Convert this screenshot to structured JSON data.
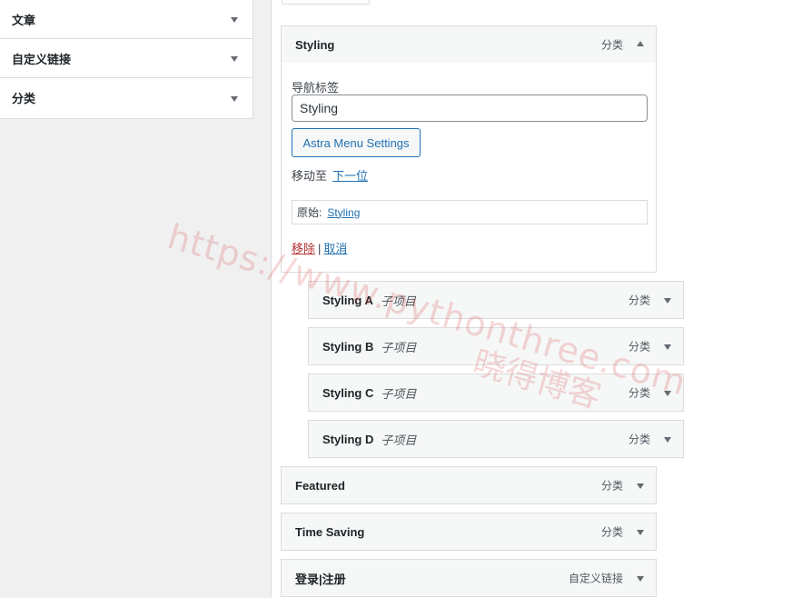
{
  "left_panel": {
    "items": [
      {
        "label": "文章"
      },
      {
        "label": "自定义链接"
      },
      {
        "label": "分类"
      }
    ]
  },
  "expanded_item": {
    "title": "Styling",
    "type": "分类",
    "nav_label_caption": "导航标签",
    "nav_label_value": "Styling",
    "astra_button": "Astra Menu Settings",
    "move_to_caption": "移动至",
    "move_next_link": "下一位",
    "original_caption": "原始:",
    "original_link": "Styling",
    "remove_link": "移除",
    "separator": "|",
    "cancel_link": "取消"
  },
  "sub_items": [
    {
      "title": "Styling A",
      "sub": "子项目",
      "type": "分类"
    },
    {
      "title": "Styling B",
      "sub": "子项目",
      "type": "分类"
    },
    {
      "title": "Styling C",
      "sub": "子项目",
      "type": "分类"
    },
    {
      "title": "Styling D",
      "sub": "子项目",
      "type": "分类"
    }
  ],
  "top_items": [
    {
      "title": "Featured",
      "type": "分类"
    },
    {
      "title": "Time Saving",
      "type": "分类"
    },
    {
      "title": "登录|注册",
      "type": "自定义链接"
    }
  ],
  "watermark": {
    "line1": "https://www.pythonthree.com",
    "line2": "晓得博客",
    "color": "#d64949"
  },
  "colors": {
    "link": "#2271b1",
    "danger": "#b32d2e",
    "bar_bg": "#f6f7f7",
    "border": "#dcdcde"
  }
}
